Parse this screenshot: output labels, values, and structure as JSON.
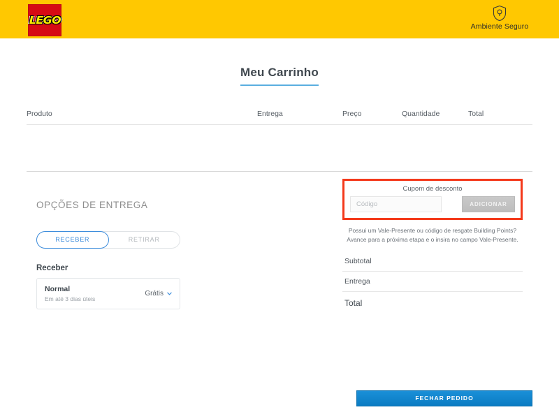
{
  "header": {
    "logo_text": "LEGO",
    "secure": {
      "icon": "shield-lock-icon",
      "label": "Ambiente Seguro"
    },
    "background_color": "#ffc801"
  },
  "page": {
    "title": "Meu Carrinho",
    "title_underline_color": "#5aaee0"
  },
  "cart_table": {
    "columns": [
      "Produto",
      "Entrega",
      "Preço",
      "Quantidade",
      "Total"
    ],
    "rows": []
  },
  "delivery": {
    "section_title": "OPÇÕES DE ENTREGA",
    "toggle": {
      "options": [
        {
          "label": "RECEBER",
          "active": true
        },
        {
          "label": "RETIRAR",
          "active": false
        }
      ],
      "active_color": "#3d8ddc"
    },
    "sub_heading": "Receber",
    "method": {
      "name": "Normal",
      "eta": "Em até 3 dias úteis",
      "price": "Grátis",
      "chevron_icon": "chevron-down-icon"
    }
  },
  "coupon": {
    "label": "Cupom de desconto",
    "input_placeholder": "Código",
    "input_value": "",
    "button_label": "ADICIONAR",
    "highlight_color": "#f4391b"
  },
  "gift_note": {
    "line1": "Possui um Vale-Presente ou código de resgate Building Points?",
    "line2": "Avance para a próxima etapa e o insira no campo Vale-Presente."
  },
  "totals": [
    {
      "label": "Subtotal",
      "value": ""
    },
    {
      "label": "Entrega",
      "value": ""
    },
    {
      "label": "Total",
      "value": ""
    }
  ],
  "checkout": {
    "label": "FECHAR PEDIDO",
    "color": "#1180cc"
  }
}
